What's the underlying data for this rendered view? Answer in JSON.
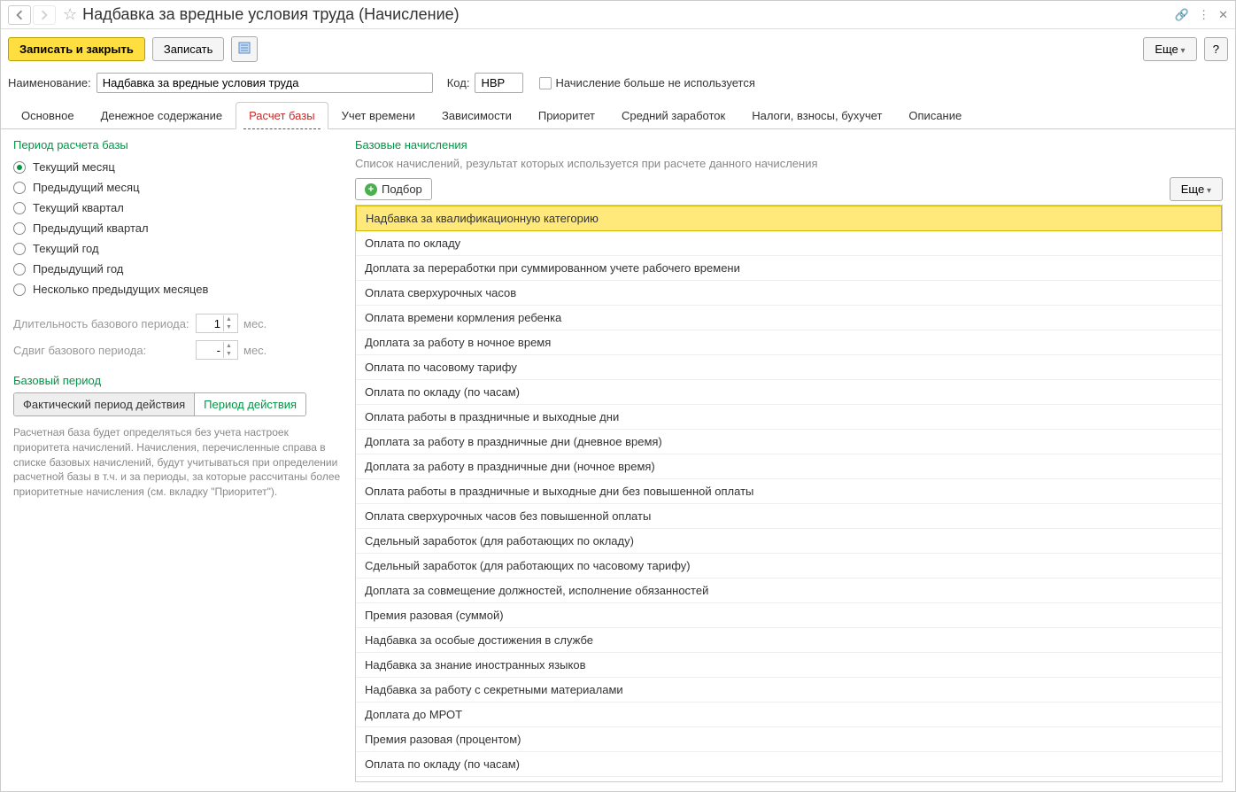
{
  "title": "Надбавка за вредные условия труда (Начисление)",
  "toolbar": {
    "save_close": "Записать и закрыть",
    "save": "Записать",
    "more": "Еще",
    "help": "?"
  },
  "form": {
    "name_label": "Наименование:",
    "name_value": "Надбавка за вредные условия труда",
    "code_label": "Код:",
    "code_value": "НВР",
    "not_used_label": "Начисление больше не используется"
  },
  "tabs": [
    "Основное",
    "Денежное содержание",
    "Расчет базы",
    "Учет времени",
    "Зависимости",
    "Приоритет",
    "Средний заработок",
    "Налоги, взносы, бухучет",
    "Описание"
  ],
  "left": {
    "period_title": "Период расчета базы",
    "radios": [
      "Текущий месяц",
      "Предыдущий месяц",
      "Текущий квартал",
      "Предыдущий квартал",
      "Текущий год",
      "Предыдущий год",
      "Несколько предыдущих месяцев"
    ],
    "duration_label": "Длительность базового периода:",
    "duration_value": "1",
    "duration_unit": "мес.",
    "shift_label": "Сдвиг базового периода:",
    "shift_value": "-",
    "shift_unit": "мес.",
    "base_period_title": "Базовый период",
    "seg_actual": "Фактический период действия",
    "seg_period": "Период действия",
    "note": "Расчетная база будет определяться без учета настроек приоритета начислений. Начисления, перечисленные справа в списке базовых начислений, будут учитываться при определении расчетной базы в т.ч. и за периоды, за которые рассчитаны более приоритетные начисления (см. вкладку \"Приоритет\")."
  },
  "right": {
    "title": "Базовые начисления",
    "hint": "Список начислений, результат которых используется при расчете данного начисления",
    "add": "Подбор",
    "more": "Еще",
    "items": [
      "Надбавка за квалификационную категорию",
      "Оплата по окладу",
      "Доплата за переработки при суммированном учете рабочего времени",
      "Оплата сверхурочных часов",
      "Оплата времени кормления ребенка",
      "Доплата за работу в ночное время",
      "Оплата по часовому тарифу",
      "Оплата по окладу (по часам)",
      "Оплата работы в праздничные и выходные дни",
      "Доплата за работу в праздничные дни (дневное время)",
      "Доплата за работу в праздничные дни (ночное время)",
      "Оплата работы в праздничные и выходные дни без повышенной оплаты",
      "Оплата сверхурочных часов без повышенной оплаты",
      "Сдельный заработок (для работающих по окладу)",
      "Сдельный заработок (для работающих по часовому тарифу)",
      "Доплата за совмещение должностей, исполнение обязанностей",
      "Премия разовая (суммой)",
      "Надбавка за особые достижения в службе",
      "Надбавка за знание иностранных языков",
      "Надбавка за работу с секретными материалами",
      "Доплата до МРОТ",
      "Премия разовая (процентом)",
      "Оплата по окладу (по часам)"
    ]
  }
}
